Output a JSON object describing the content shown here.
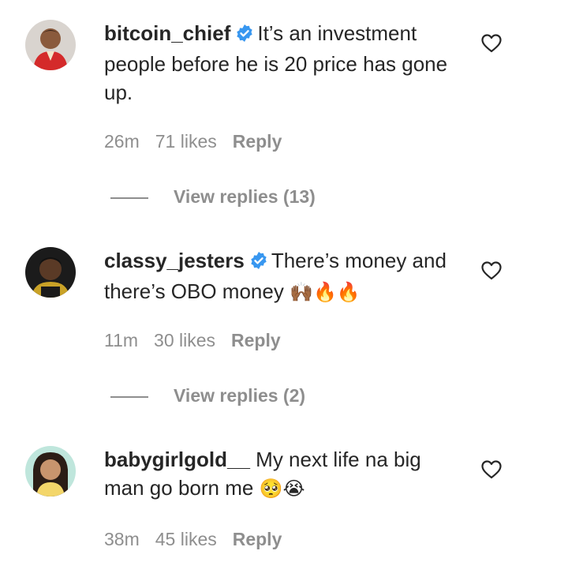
{
  "comments": [
    {
      "username": "bitcoin_chief",
      "text": "It’s an investment people before he is 20 price has gone up.",
      "time": "26m",
      "likes": "71 likes",
      "reply_label": "Reply",
      "view_replies": "View replies (13)",
      "verified": true
    },
    {
      "username": "classy_jesters",
      "text": "There’s money and there’s OBO money",
      "emojis": "🙌🏾🔥🔥",
      "time": "11m",
      "likes": "30 likes",
      "reply_label": "Reply",
      "view_replies": "View replies (2)",
      "verified": true
    },
    {
      "username": "babygirlgold__",
      "text": "My next life na big man go born me",
      "emojis": "🥺😭",
      "time": "38m",
      "likes": "45 likes",
      "reply_label": "Reply",
      "verified": false
    }
  ],
  "colors": {
    "verified_badge": "#3897f0",
    "meta_text": "#8e8e8e",
    "body_text": "#262626"
  },
  "icons": [
    "verified-badge-icon",
    "heart-icon"
  ]
}
